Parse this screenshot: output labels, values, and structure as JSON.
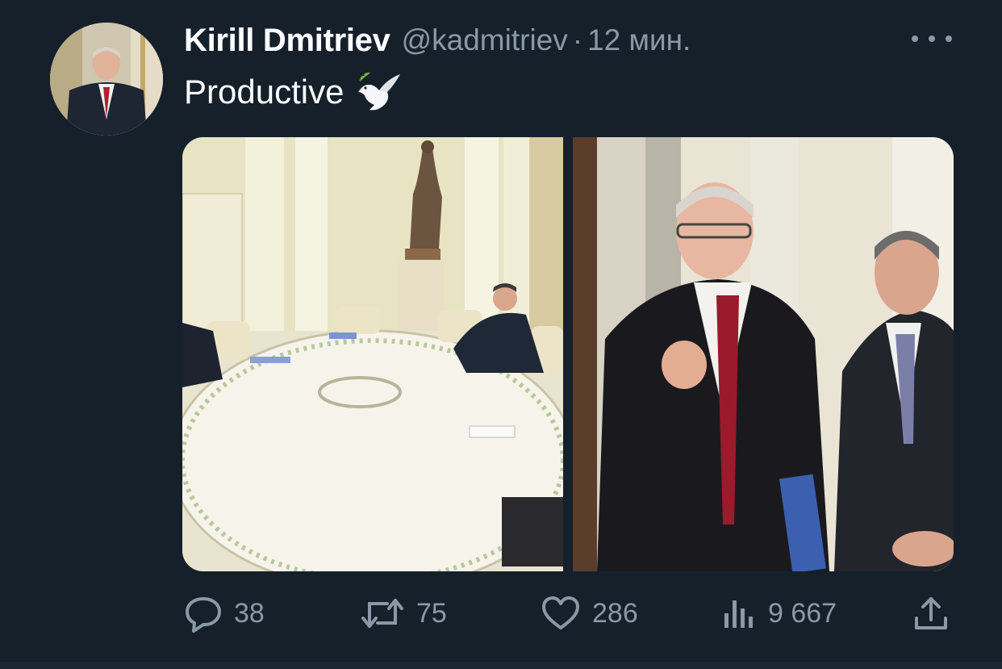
{
  "author": {
    "display_name": "Kirill Dmitriev",
    "handle": "@kadmitriev",
    "separator": "·",
    "timestamp": "12 мин."
  },
  "tweet": {
    "text": "Productive",
    "emoji": "dove-with-olive-branch"
  },
  "media": {
    "count": 2
  },
  "actions": {
    "replies": "38",
    "retweets": "75",
    "likes": "286",
    "views": "9 667"
  },
  "colors": {
    "background": "#15202b",
    "secondary_text": "#8b98a5",
    "primary_text": "#ffffff"
  },
  "icons": [
    "more-icon",
    "reply-icon",
    "retweet-icon",
    "like-icon",
    "views-icon",
    "share-icon"
  ]
}
